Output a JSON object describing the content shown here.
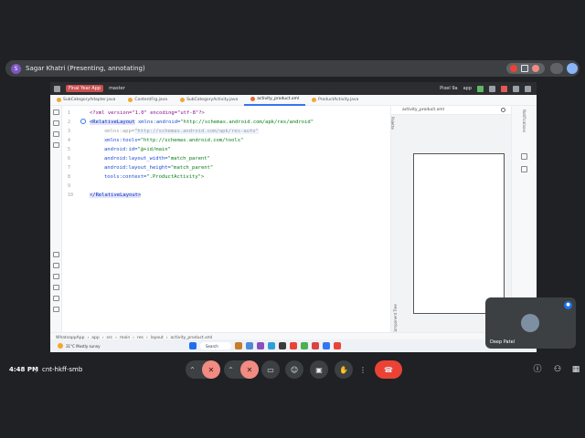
{
  "meet": {
    "presenter_initial": "S",
    "presenter_text": "Sagar Khatri (Presenting, annotating)",
    "time": "4:48 PM",
    "separator": "|",
    "meeting_code": "cnt-hkff-smb",
    "participant_name": "Deep Patel",
    "colors": {
      "end_call": "#ea4335",
      "muted_btn": "#f28b82",
      "pip_mic": "#1a73e8"
    }
  },
  "ide": {
    "project_label": "Final Year App",
    "branch_label": "master",
    "device_label": "Pixel 9a",
    "run_config": "app",
    "tabs": [
      {
        "label": "SubCategoryAdapter.java",
        "active": false
      },
      {
        "label": "ContentFrg.java",
        "active": false
      },
      {
        "label": "SubCategoryActivity.java",
        "active": false
      },
      {
        "label": "activity_product.xml",
        "active": true
      },
      {
        "label": "ProductActivity.java",
        "active": false
      }
    ],
    "line_numbers": [
      "1",
      "2",
      "3",
      "4",
      "5",
      "6",
      "7",
      "8",
      "9",
      "10"
    ],
    "code": {
      "l1": "<?xml version=\"1.0\" encoding=\"utf-8\"?>",
      "l2_tag": "<RelativeLayout",
      "l2_attr": " xmlns:android=",
      "l2_val": "\"http://schemas.android.com/apk/res/android\"",
      "l3_attr": "xmlns:app=",
      "l3_val": "\"http://schemas.android.com/apk/res-auto\"",
      "l4_attr": "xmlns:tools=",
      "l4_val": "\"http://schemas.android.com/tools\"",
      "l5_attr": "android:id=",
      "l5_val": "\"@+id/main\"",
      "l6_attr": "android:layout_width=",
      "l6_val": "\"match_parent\"",
      "l7_attr": "android:layout_height=",
      "l7_val": "\"match_parent\"",
      "l8_attr": "tools:context=",
      "l8_val": "\".ProductActivity\">",
      "l10": "</RelativeLayout>"
    },
    "preview_label": "activity_product.xml",
    "side_label_project": "Project",
    "side_label_palette": "Palette",
    "side_label_component_tree": "Component Tree",
    "side_label_notifications": "Notifications",
    "breadcrumb": [
      "WhatsappApp",
      "app",
      "src",
      "main",
      "res",
      "layout",
      "activity_product.xml"
    ],
    "status_right": "UTF-8",
    "taskbar": {
      "weather_temp": "31°C",
      "weather_desc": "Mostly sunny",
      "search_placeholder": "Search"
    }
  }
}
